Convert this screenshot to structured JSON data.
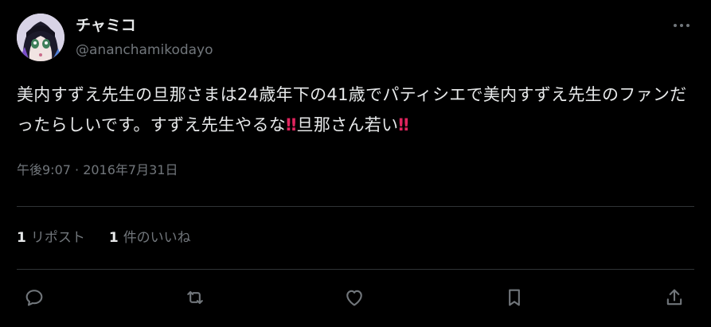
{
  "author": {
    "display_name": "チャミコ",
    "handle": "@ananchamikodayo",
    "avatar_icon": "anime-girl-avatar"
  },
  "tweet": {
    "text_part1": "美内すずえ先生の旦那さまは24歳年下の41歳でパティシエで美内すずえ先生のファンだったらしいです。すずえ先生やるな",
    "emoji1": "‼",
    "text_part2": "旦那さん若い",
    "emoji2": "‼",
    "emoji_color": "#e0245e",
    "timestamp": "午後9:07 · 2016年7月31日"
  },
  "stats": {
    "retweets_count": "1",
    "retweets_label": "リポスト",
    "likes_count": "1",
    "likes_label": "件のいいね"
  },
  "actions": {
    "reply_icon": "reply-icon",
    "retweet_icon": "retweet-icon",
    "like_icon": "heart-icon",
    "bookmark_icon": "bookmark-icon",
    "share_icon": "share-icon"
  },
  "colors": {
    "background": "#000000",
    "text": "#e7e9ea",
    "secondary": "#71767b",
    "divider": "#2f3336"
  }
}
